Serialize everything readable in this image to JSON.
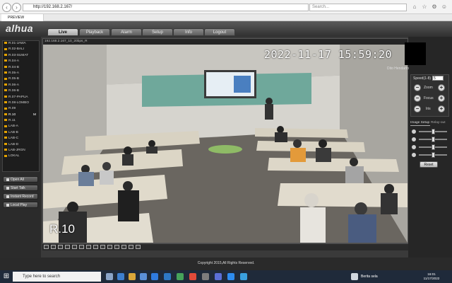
{
  "browser": {
    "url": "http://192.168.2.167/",
    "search_placeholder": "Search...",
    "tab_title": "PREVIEW"
  },
  "app": {
    "logo": "alhua",
    "nav_tabs": [
      "Live",
      "Playback",
      "Alarm",
      "Setup",
      "Info",
      "Logout"
    ],
    "active_tab": "Live"
  },
  "channels": [
    {
      "label": "R.01-JAWA",
      "active": false
    },
    {
      "label": "R.02-BALI",
      "active": false
    },
    {
      "label": "R.03-SUMAT",
      "active": false
    },
    {
      "label": "R.04-A",
      "active": false
    },
    {
      "label": "R.04-B",
      "active": false
    },
    {
      "label": "R.05-A",
      "active": false
    },
    {
      "label": "R.05-B",
      "active": false
    },
    {
      "label": "R.06-A",
      "active": false
    },
    {
      "label": "R.06-B",
      "active": false
    },
    {
      "label": "R.07-PAPUA",
      "active": false
    },
    {
      "label": "R.08-LOMBO",
      "active": false
    },
    {
      "label": "R.09",
      "active": false
    },
    {
      "label": "R.10",
      "active": true,
      "marker": "M"
    },
    {
      "label": "R.11",
      "active": false
    },
    {
      "label": "LAB-A",
      "active": false
    },
    {
      "label": "LAB-B",
      "active": false
    },
    {
      "label": "LAB-C",
      "active": false
    },
    {
      "label": "LAB-D",
      "active": false
    },
    {
      "label": "LAB-JRGN",
      "active": false
    },
    {
      "label": "LOKAL",
      "active": false
    }
  ],
  "side_buttons": [
    "Open All",
    "Start Talk",
    "Instant Record",
    "Local Play"
  ],
  "video": {
    "title": "192.168.2.167_10_20bps_R",
    "timestamp": "2022-11-17 15:59:20",
    "channel_name": "R.10"
  },
  "right_panel": {
    "user_label": "Dito Hendarto",
    "speed_label": "Speed(1-8)",
    "speed_value": "5",
    "ptz_labels": [
      "Zoom",
      "Focus",
      "Iris"
    ],
    "image_setup_tab": "Image Setup",
    "relay_tab": "Relay-out",
    "reset_label": "Reset",
    "sliders": [
      0.5,
      0.5,
      0.5,
      0.5
    ]
  },
  "footer": {
    "copyright": "Copyright 2015,All Rights Reserved."
  },
  "taskbar": {
    "search_placeholder": "Type here to search",
    "tray_text": "Berita sela",
    "time": "16:01",
    "date": "11/17/2022"
  }
}
